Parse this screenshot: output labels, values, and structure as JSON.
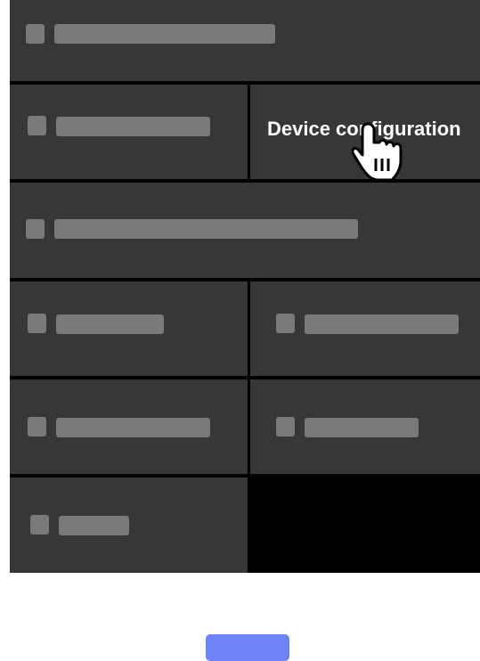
{
  "tiles": {
    "device_configuration": {
      "label": "Device configuration"
    }
  },
  "cursor": {
    "icon": "hand-pointer-icon"
  },
  "colors": {
    "tile_background": "#373737",
    "grid_gap": "#000000",
    "placeholder": "#7a7a7a",
    "primary_button": "#6e84f4",
    "label_text": "#ffffff"
  }
}
